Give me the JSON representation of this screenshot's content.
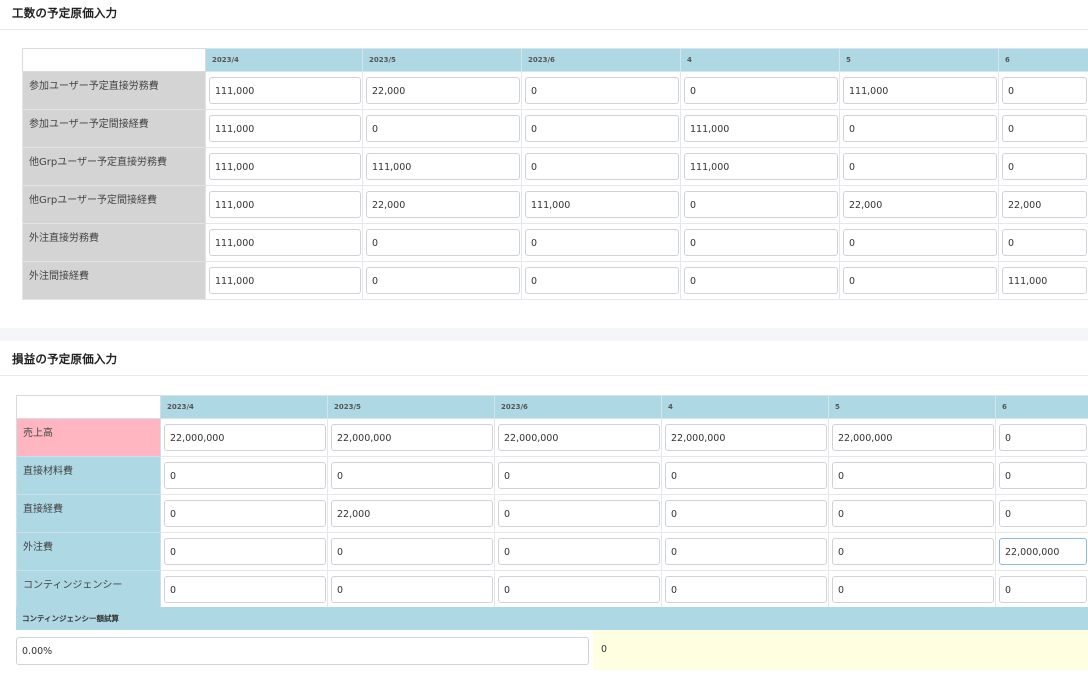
{
  "cost_section": {
    "title": "工数の予定原価入力",
    "months": [
      "2023/4",
      "2023/5",
      "2023/6",
      "4",
      "5",
      "6"
    ],
    "rows": [
      {
        "label": "参加ユーザー予定直接労務費",
        "values": [
          "111,000",
          "22,000",
          "0",
          "0",
          "111,000",
          "0"
        ]
      },
      {
        "label": "参加ユーザー予定間接経費",
        "values": [
          "111,000",
          "0",
          "0",
          "111,000",
          "0",
          "0"
        ]
      },
      {
        "label": "他Grpユーザー予定直接労務費",
        "values": [
          "111,000",
          "111,000",
          "0",
          "111,000",
          "0",
          "0"
        ]
      },
      {
        "label": "他Grpユーザー予定間接経費",
        "values": [
          "111,000",
          "22,000",
          "111,000",
          "0",
          "22,000",
          "22,000"
        ]
      },
      {
        "label": "外注直接労務費",
        "values": [
          "111,000",
          "0",
          "0",
          "0",
          "0",
          "0"
        ]
      },
      {
        "label": "外注間接経費",
        "values": [
          "111,000",
          "0",
          "0",
          "0",
          "0",
          "111,000"
        ]
      }
    ]
  },
  "pl_section": {
    "title": "損益の予定原価入力",
    "months": [
      "2023/4",
      "2023/5",
      "2023/6",
      "4",
      "5",
      "6"
    ],
    "rows": [
      {
        "label": "売上高",
        "values": [
          "22,000,000",
          "22,000,000",
          "22,000,000",
          "22,000,000",
          "22,000,000",
          "0"
        ]
      },
      {
        "label": "直接材料費",
        "values": [
          "0",
          "0",
          "0",
          "0",
          "0",
          "0"
        ]
      },
      {
        "label": "直接経費",
        "values": [
          "0",
          "22,000",
          "0",
          "0",
          "0",
          "0"
        ]
      },
      {
        "label": "外注費",
        "values": [
          "0",
          "0",
          "0",
          "0",
          "0",
          "22,000,000"
        ]
      },
      {
        "label": "コンティンジェンシー",
        "values": [
          "0",
          "0",
          "0",
          "0",
          "0",
          "0"
        ]
      }
    ],
    "contingency": {
      "header": "コンティンジェンシー額試算",
      "rate": "0.00%",
      "result": "0"
    }
  },
  "colors": {
    "header_blue": "#aed8e4",
    "label_gray": "#d4d4d4",
    "sales_pink": "#ffb6c1",
    "result_yellow": "#fffee0"
  }
}
